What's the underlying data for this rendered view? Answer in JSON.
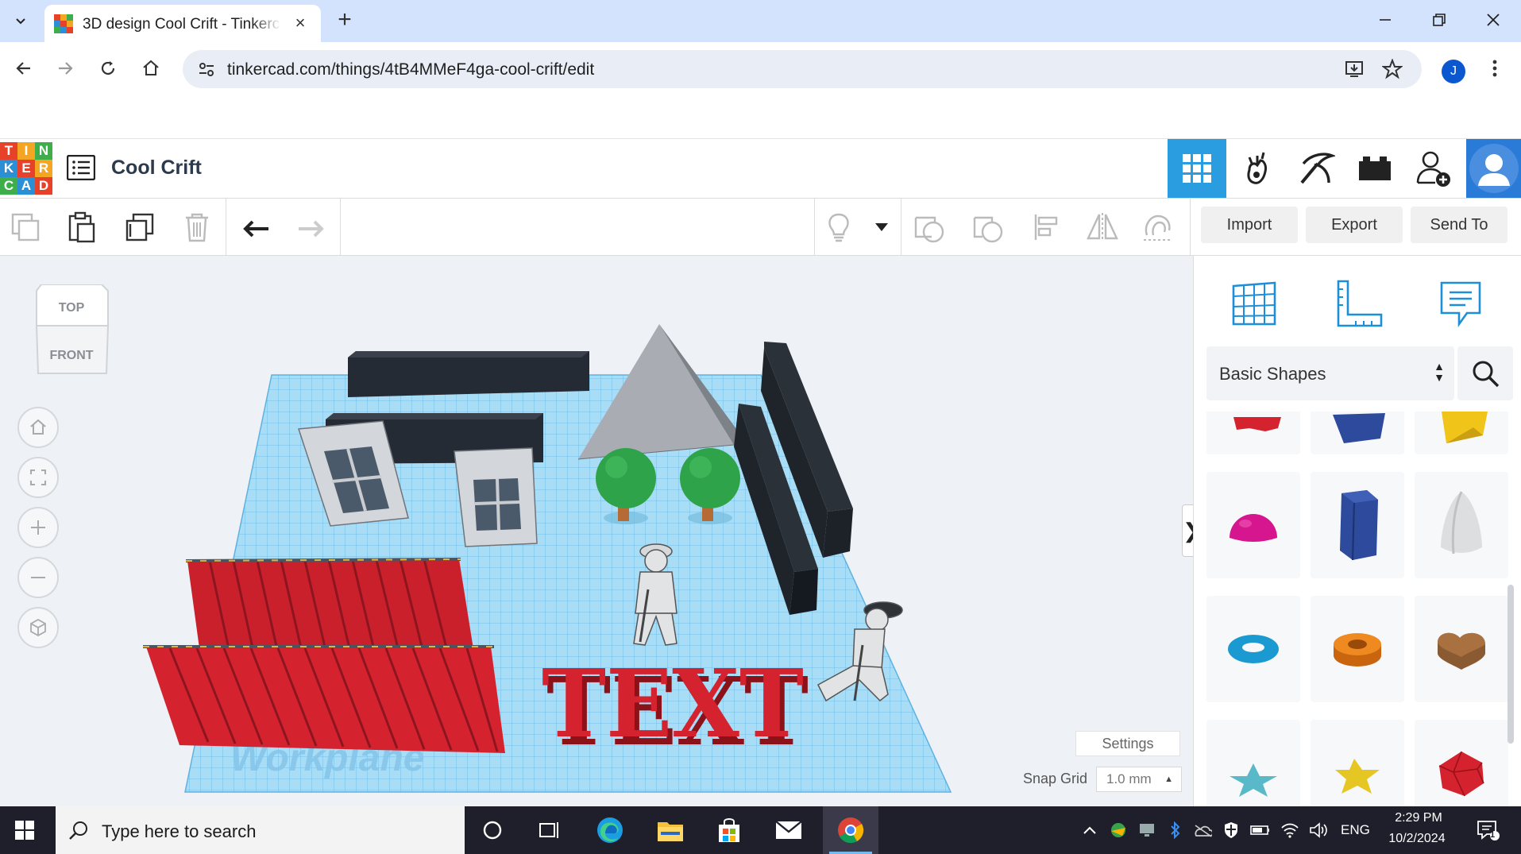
{
  "browser": {
    "tab_title": "3D design Cool Crift - Tinkercad",
    "url": "tinkercad.com/things/4tB4MMeF4ga-cool-crift/edit",
    "profile_initial": "J"
  },
  "app": {
    "logo_letters": [
      "T",
      "I",
      "N",
      "K",
      "E",
      "R",
      "C",
      "A",
      "D"
    ],
    "logo_colors": [
      "#e8412a",
      "#f4a622",
      "#3dae4a",
      "#2b8fd6",
      "#e8412a",
      "#f4a622",
      "#3dae4a",
      "#2b8fd6",
      "#e8412a"
    ],
    "design_title": "Cool Crift",
    "header_icons": [
      "grid-view-icon",
      "sim-lab-icon",
      "pickaxe-icon",
      "bricks-icon",
      "add-user-icon",
      "user-avatar"
    ],
    "accent": "#2a9ce0"
  },
  "toolbar": {
    "import_label": "Import",
    "export_label": "Export",
    "send_to_label": "Send To"
  },
  "viewport": {
    "viewcube_top": "TOP",
    "viewcube_front": "FRONT",
    "workplane_label": "Workplane",
    "scene_text": "TEXT",
    "settings_label": "Settings",
    "snap_grid_label": "Snap Grid",
    "snap_grid_value": "1.0 mm"
  },
  "shapes_panel": {
    "category": "Basic Shapes",
    "shapes": [
      "half-sphere",
      "polygon-prism",
      "paraboloid",
      "torus",
      "tube",
      "heart",
      "star-flat",
      "star",
      "icosahedron"
    ]
  },
  "taskbar": {
    "search_placeholder": "Type here to search",
    "language": "ENG",
    "time": "2:29 PM",
    "date": "10/2/2024",
    "notification_count": "1"
  }
}
